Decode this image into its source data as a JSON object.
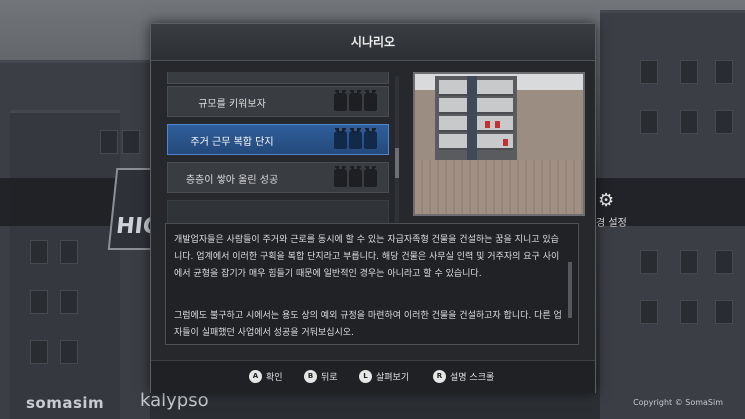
{
  "modal": {
    "title": "시나리오"
  },
  "scenarios": [
    {
      "label": "규모를 키워보자",
      "selected": false
    },
    {
      "label": "주거 근무 복합 단지",
      "selected": true
    },
    {
      "label": "층층이 쌓아 올린 성공",
      "selected": false
    }
  ],
  "description": {
    "paragraph1": "개발업자들은 사람들이 주거와 근로를 동시에 할 수 있는 자급자족형 건물을 건설하는 꿈을 지니고 있습니다. 업계에서 이러한 구획을 복합 단지라고 부릅니다. 해당 건물은 사무실 인력 및 거주자의 요구 사이에서 균형을 잡기가 매우 힘들기 때문에 일반적인 경우는 아니라고 할 수 있습니다.",
    "paragraph2": "그럼에도 불구하고 시에서는 용도 상의 예외 규정을 마련하여 이러한 건물을 건설하고자 합니다. 다른 업자들이 실패했던 사업에서 성공을 거둬보십시오."
  },
  "footer": {
    "hints": [
      {
        "key": "A",
        "label": "확인"
      },
      {
        "key": "B",
        "label": "뒤로"
      },
      {
        "key": "L",
        "label": "살펴보기"
      },
      {
        "key": "R",
        "label": "설명 스크롤"
      }
    ]
  },
  "background": {
    "settings_label": "경 설정",
    "logo_text": "HIG",
    "brand_left": "somasim",
    "brand_right": "kalypso",
    "copyright": "Copyright © SomaSim"
  },
  "colors": {
    "selected": "#2f5f9c",
    "panel": "#26282c"
  }
}
